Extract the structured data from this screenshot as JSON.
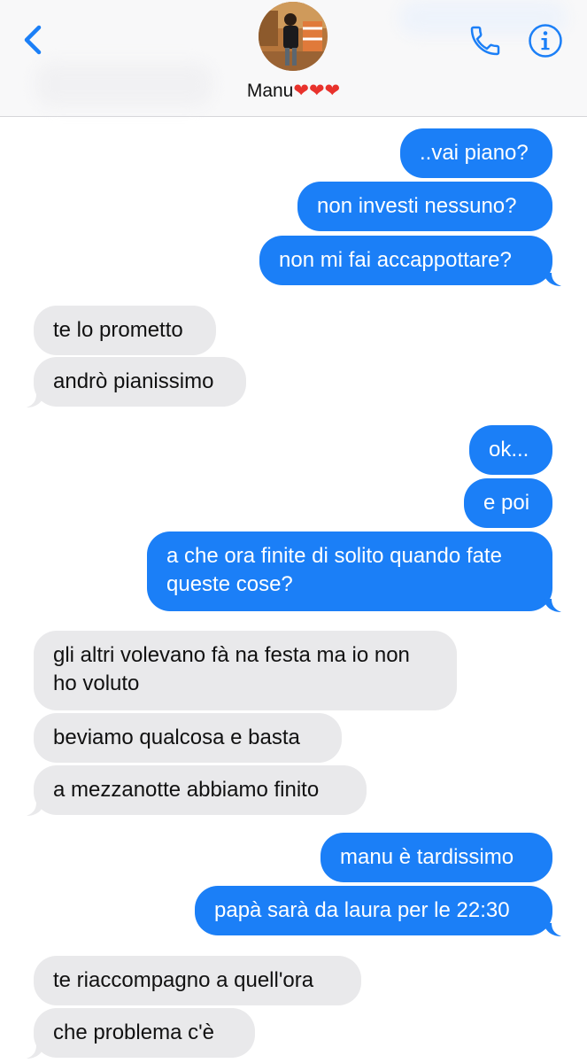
{
  "header": {
    "contact_name": "Manu",
    "contact_hearts": "❤❤❤"
  },
  "colors": {
    "accent": "#1b7ff7",
    "incoming_bubble": "#e9e9eb",
    "outgoing_text": "#ffffff",
    "incoming_text": "#111111"
  },
  "icons": [
    "back-chevron-icon",
    "phone-icon",
    "info-icon"
  ],
  "messages": [
    {
      "direction": "out",
      "text": "..vai piano?"
    },
    {
      "direction": "out",
      "text": "non investi nessuno?"
    },
    {
      "direction": "out",
      "text": "non mi fai accappottare?"
    },
    {
      "direction": "in",
      "text": "te lo prometto"
    },
    {
      "direction": "in",
      "text": "andrò pianissimo"
    },
    {
      "direction": "out",
      "text": "ok..."
    },
    {
      "direction": "out",
      "text": "e poi"
    },
    {
      "direction": "out",
      "line1": "a che ora finite di solito quando fate",
      "line2": "queste cose?"
    },
    {
      "direction": "in",
      "line1": "gli altri volevano fà na festa ma io non",
      "line2": "ho voluto"
    },
    {
      "direction": "in",
      "text": "beviamo qualcosa e basta"
    },
    {
      "direction": "in",
      "text": "a mezzanotte abbiamo finito"
    },
    {
      "direction": "out",
      "text": "manu è tardissimo"
    },
    {
      "direction": "out",
      "text": "papà sarà da laura per le 22:30"
    },
    {
      "direction": "in",
      "text": "te riaccompagno a quell'ora"
    },
    {
      "direction": "in",
      "text": "che problema c'è"
    }
  ]
}
